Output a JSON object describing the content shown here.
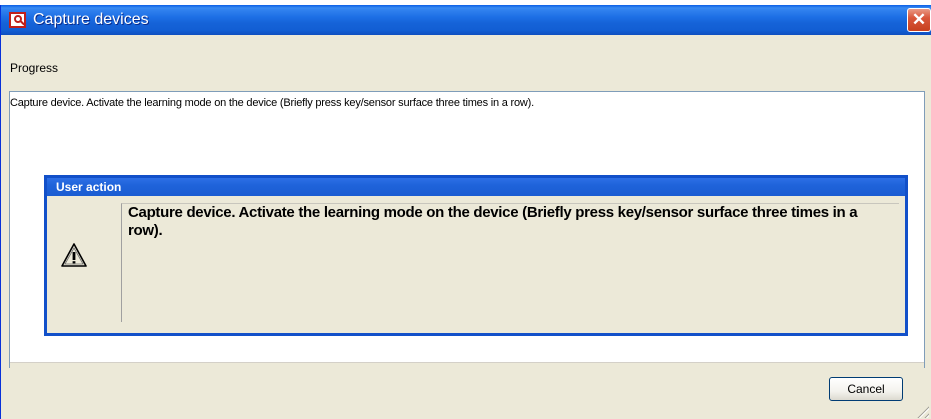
{
  "window": {
    "title": "Capture devices",
    "close_label": "✕"
  },
  "progress": {
    "label": "Progress",
    "log_text": "Capture device. Activate the learning mode on the device (Briefly press key/sensor surface three times in a row)."
  },
  "dialog": {
    "title": "User action",
    "message": "Capture device. Activate the learning mode on the device (Briefly press key/sensor surface three times in a row).",
    "icon": "warning-icon"
  },
  "footer": {
    "cancel_label": "Cancel"
  },
  "colors": {
    "titlebar": "#1563d8",
    "dialog_border": "#1250c9",
    "window_bg": "#ece9d8",
    "close_button": "#d9573c"
  }
}
